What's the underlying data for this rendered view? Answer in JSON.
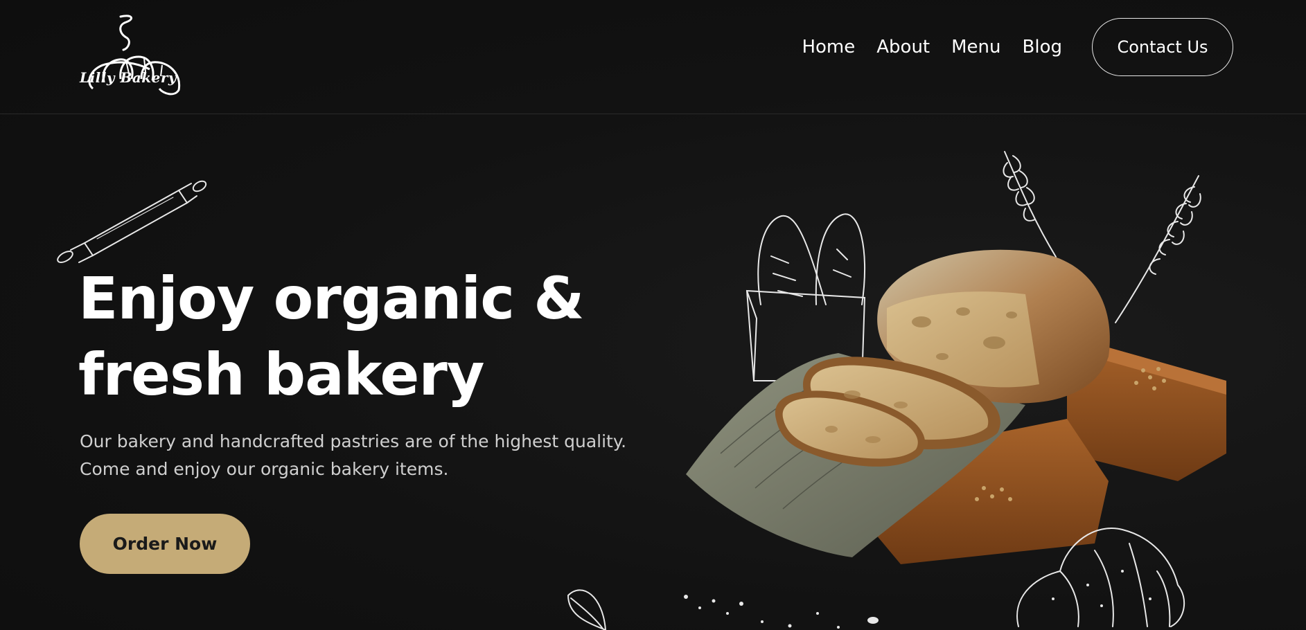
{
  "brand": {
    "logo_text": "Lilly Bakery"
  },
  "nav": {
    "items": [
      "Home",
      "About",
      "Menu",
      "Blog"
    ],
    "contact_label": "Contact Us"
  },
  "hero": {
    "title_line1": "Enjoy organic &",
    "title_line2": "fresh bakery",
    "desc_line1": "Our bakery and handcrafted pastries are of the highest quality.",
    "desc_line2": "Come and enjoy our organic bakery items.",
    "cta_label": "Order Now"
  },
  "colors": {
    "background": "#121212",
    "accent": "#c5ab77",
    "text": "#ffffff",
    "muted_text": "#cfcfcf"
  },
  "icons": [
    "bakery-logo-icon",
    "rolling-pin-icon",
    "baguette-bag-icon",
    "wheat-icon",
    "croissant-icon",
    "leaf-icon",
    "bread-image"
  ]
}
